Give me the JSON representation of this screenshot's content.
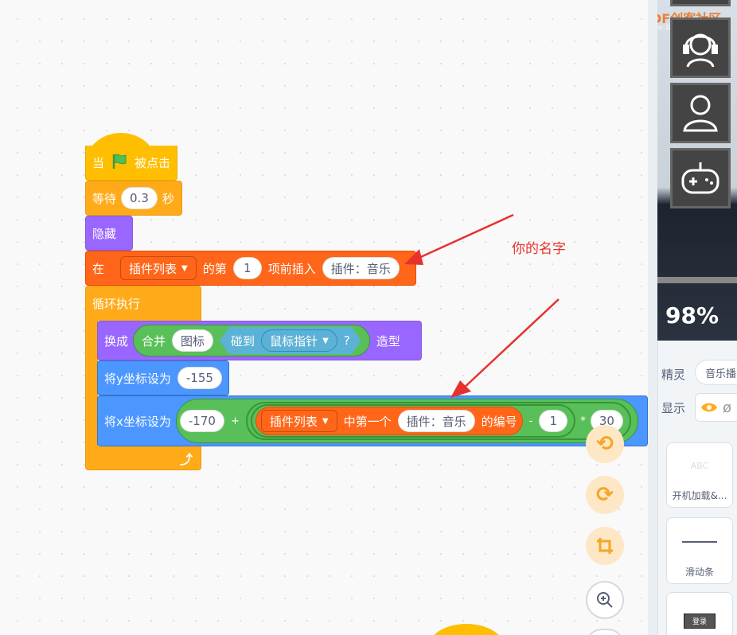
{
  "code": {
    "hat": {
      "when": "当",
      "flag_icon": "green-flag-icon",
      "clicked": "被点击"
    },
    "wait": {
      "label": "等待",
      "value": "0.3",
      "unit": "秒"
    },
    "hide": {
      "label": "隐藏"
    },
    "insert": {
      "at": "在",
      "list": "插件列表",
      "nth": "的第",
      "index": "1",
      "before": "项前插入",
      "item": "插件：音乐"
    },
    "forever": {
      "label": "循环执行",
      "loop_icon": "loop-arrow-icon"
    },
    "switch_costume": {
      "label": "换成",
      "join": "合并",
      "text": "图标",
      "touching": "碰到",
      "target": "鼠标指针",
      "q": "?",
      "costume": "造型"
    },
    "set_y": {
      "label": "将y坐标设为",
      "value": "-155"
    },
    "set_x": {
      "label": "将x坐标设为",
      "base": "-170",
      "plus": "+",
      "list": "插件列表",
      "item_num_of": "中第一个",
      "item": "插件：音乐",
      "index_of": "的编号",
      "minus": "-",
      "sub": "1",
      "times": "*",
      "mul": "30"
    }
  },
  "annotation": {
    "text": "你的名字",
    "color": "#e8312d"
  },
  "controls": {
    "undo_icon": "undo-icon",
    "redo_icon": "redo-icon",
    "crop_icon": "crop-icon",
    "zoom_in_icon": "zoom-in-icon"
  },
  "stage": {
    "watermark_brand": "DF创客社区",
    "watermark_url": "mc.DFRobot.com.cn",
    "zoom": "98%",
    "avatars": [
      "headset-avatar-icon",
      "person-avatar-icon",
      "gamepad-icon"
    ]
  },
  "sprite_panel": {
    "sprite_label": "精灵",
    "sprite_name": "音乐播",
    "show_label": "显示",
    "cards": [
      {
        "name": "开机加载&...",
        "thumb": "setting-thumb"
      },
      {
        "name": "滑动条",
        "thumb": "slider-thumb"
      },
      {
        "name": "",
        "thumb_text": "登录"
      }
    ]
  },
  "colors": {
    "events": "#ffbf00",
    "control": "#ffab19",
    "looks": "#9966ff",
    "list": "#ff661a",
    "motion": "#4c97ff",
    "operators": "#59c059",
    "sensing": "#5cb1d6"
  }
}
